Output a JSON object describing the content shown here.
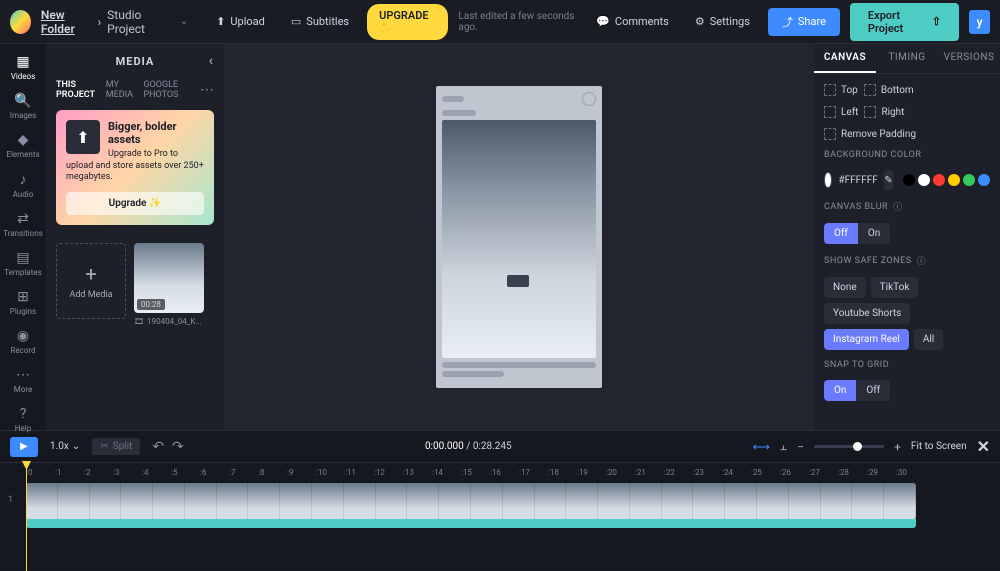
{
  "header": {
    "folder": "New Folder",
    "project": "Studio Project",
    "upload": "Upload",
    "subtitles": "Subtitles",
    "upgrade": "UPGRADE ✨",
    "last_edited": "Last edited a few seconds ago.",
    "comments": "Comments",
    "settings": "Settings",
    "share": "Share",
    "export": "Export Project",
    "avatar_letter": "y"
  },
  "leftbar": {
    "items": [
      "Videos",
      "Images",
      "Elements",
      "Audio",
      "Transitions",
      "Templates",
      "Plugins",
      "Record",
      "More",
      "Help"
    ],
    "icons": [
      "▦",
      "🔍",
      "◆",
      "♪",
      "⇄",
      "▤",
      "⊞",
      "◉",
      "⋯",
      "?"
    ]
  },
  "sidepanel": {
    "title": "MEDIA",
    "tabs": [
      "THIS PROJECT",
      "MY MEDIA",
      "GOOGLE PHOTOS"
    ],
    "promo": {
      "title": "Bigger, bolder assets",
      "text": "Upgrade to Pro to upload and store assets over 250+ megabytes.",
      "cta": "Upgrade ✨"
    },
    "add_media": "Add Media",
    "media_item": {
      "duration": "00:28",
      "name": "190404_04_K..."
    }
  },
  "rightpanel": {
    "tabs": [
      "CANVAS",
      "TIMING",
      "VERSIONS"
    ],
    "pad": {
      "top": "Top",
      "bottom": "Bottom",
      "left": "Left",
      "right": "Right",
      "remove": "Remove Padding"
    },
    "bg": {
      "label": "BACKGROUND COLOR",
      "hex": "#FFFFFF",
      "swatches": [
        "#000000",
        "#ffffff",
        "#ff3b30",
        "#ffcc00",
        "#34c759",
        "#3d8bff"
      ]
    },
    "blur": {
      "label": "CANVAS BLUR",
      "off": "Off",
      "on": "On"
    },
    "safe": {
      "label": "SHOW SAFE ZONES",
      "none": "None",
      "tiktok": "TikTok",
      "yts": "Youtube Shorts",
      "ig": "Instagram Reel",
      "all": "All"
    },
    "snap": {
      "label": "SNAP TO GRID",
      "on": "On",
      "off": "Off"
    }
  },
  "timeline": {
    "speed": "1.0x",
    "split": "Split",
    "current": "0:00.000",
    "total": "0:28.245",
    "fit": "Fit to Screen",
    "ruler": [
      ":0",
      ":1",
      ":2",
      ":3",
      ":4",
      ":5",
      ":6",
      ":7",
      ":8",
      ":9",
      ":10",
      ":11",
      ":12",
      ":13",
      ":14",
      ":15",
      ":16",
      ":17",
      ":18",
      ":19",
      ":20",
      ":21",
      ":22",
      ":23",
      ":24",
      ":25",
      ":26",
      ":27",
      ":28",
      ":29",
      ":30"
    ],
    "track": "1"
  }
}
